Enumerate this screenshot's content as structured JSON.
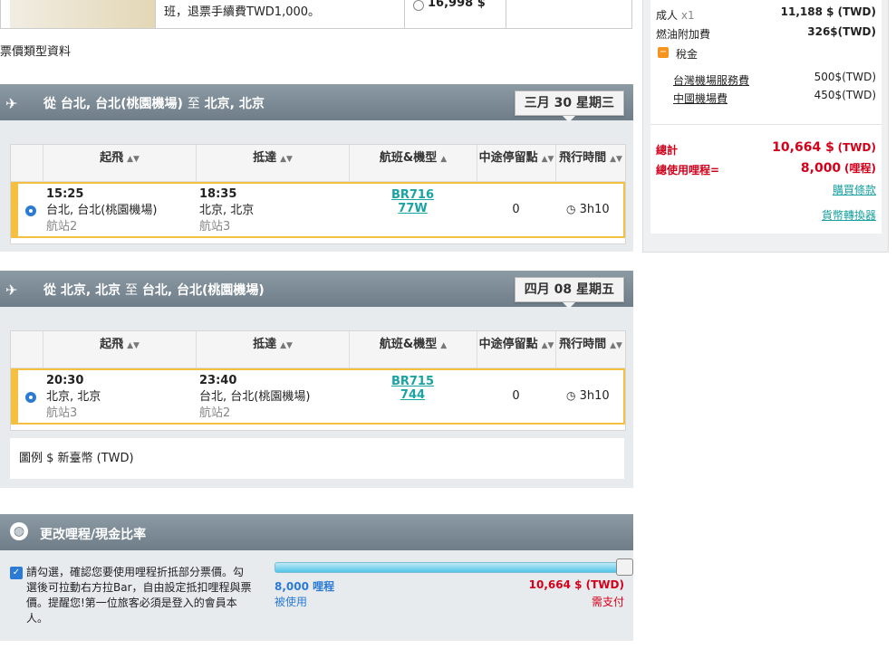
{
  "top_row": {
    "refund_text": "班，退票手續費TWD1,000。",
    "price": "16,998 $"
  },
  "fare_type_link": "票價類型資料",
  "outbound": {
    "from_label": "從",
    "from_city": "台北, 台北(桃園機場)",
    "to_label": "至",
    "to_city": "北京, 北京",
    "date": "三月 30 星期三",
    "headers": {
      "depart": "起飛",
      "arrive": "抵達",
      "flight": "航班&機型",
      "stops": "中途停留點",
      "duration": "飛行時間"
    },
    "depart_time": "15:25",
    "depart_city": "台北, 台北(桃園機場)",
    "depart_terminal": "航站2",
    "arrive_time": "18:35",
    "arrive_city": "北京, 北京",
    "arrive_terminal": "航站3",
    "flight_no": "BR716",
    "aircraft": "77W",
    "stops": "0",
    "duration": "3h10"
  },
  "inbound": {
    "from_label": "從",
    "from_city": "北京, 北京",
    "to_label": "至",
    "to_city": "台北, 台北(桃園機場)",
    "date": "四月 08 星期五",
    "headers": {
      "depart": "起飛",
      "arrive": "抵達",
      "flight": "航班&機型",
      "stops": "中途停留點",
      "duration": "飛行時間"
    },
    "depart_time": "20:30",
    "depart_city": "北京, 北京",
    "depart_terminal": "航站3",
    "arrive_time": "23:40",
    "arrive_city": "台北, 台北(桃園機場)",
    "arrive_terminal": "航站2",
    "flight_no": "BR715",
    "aircraft": "744",
    "stops": "0",
    "duration": "3h10"
  },
  "legend": "圖例 $ 新臺幣 (TWD)",
  "summary": {
    "adult_label": "成人",
    "adult_count": "x1",
    "adult_price": "11,188 $ (TWD)",
    "fuel_label": "燃油附加費",
    "fuel_price": "326$(TWD)",
    "tax_label": "稅金",
    "taiwan_fee_label": "台灣機場服務費",
    "taiwan_fee": "500$(TWD)",
    "china_fee_label": "中國機場費",
    "china_fee": "450$(TWD)",
    "total_label": "總計",
    "total_amount": "10,664 $",
    "total_currency": "(TWD)",
    "miles_label": "總使用哩程=",
    "miles_amount": "8,000",
    "miles_unit": "(哩程)",
    "terms_link": "購買條款",
    "converter_link": "貨幣轉換器"
  },
  "mileage": {
    "title": "更改哩程/現金比率",
    "checkbox_text": "請勾選，確認您要使用哩程折抵部分票價。勾選後可拉動右方拉Bar，自由設定抵扣哩程與票價。提醒您!第一位旅客必須是登入的會員本人。",
    "miles_used": "8,000 哩程",
    "miles_used_label": "被使用",
    "cash_amount": "10,664 $ (TWD)",
    "cash_label": "需支付",
    "slider_level": 1.0
  },
  "colors": {
    "accent_gold": "#f5c040",
    "link_teal": "#1aa3a3",
    "price_red": "#d4001a",
    "band_gray": "#7a8893"
  }
}
